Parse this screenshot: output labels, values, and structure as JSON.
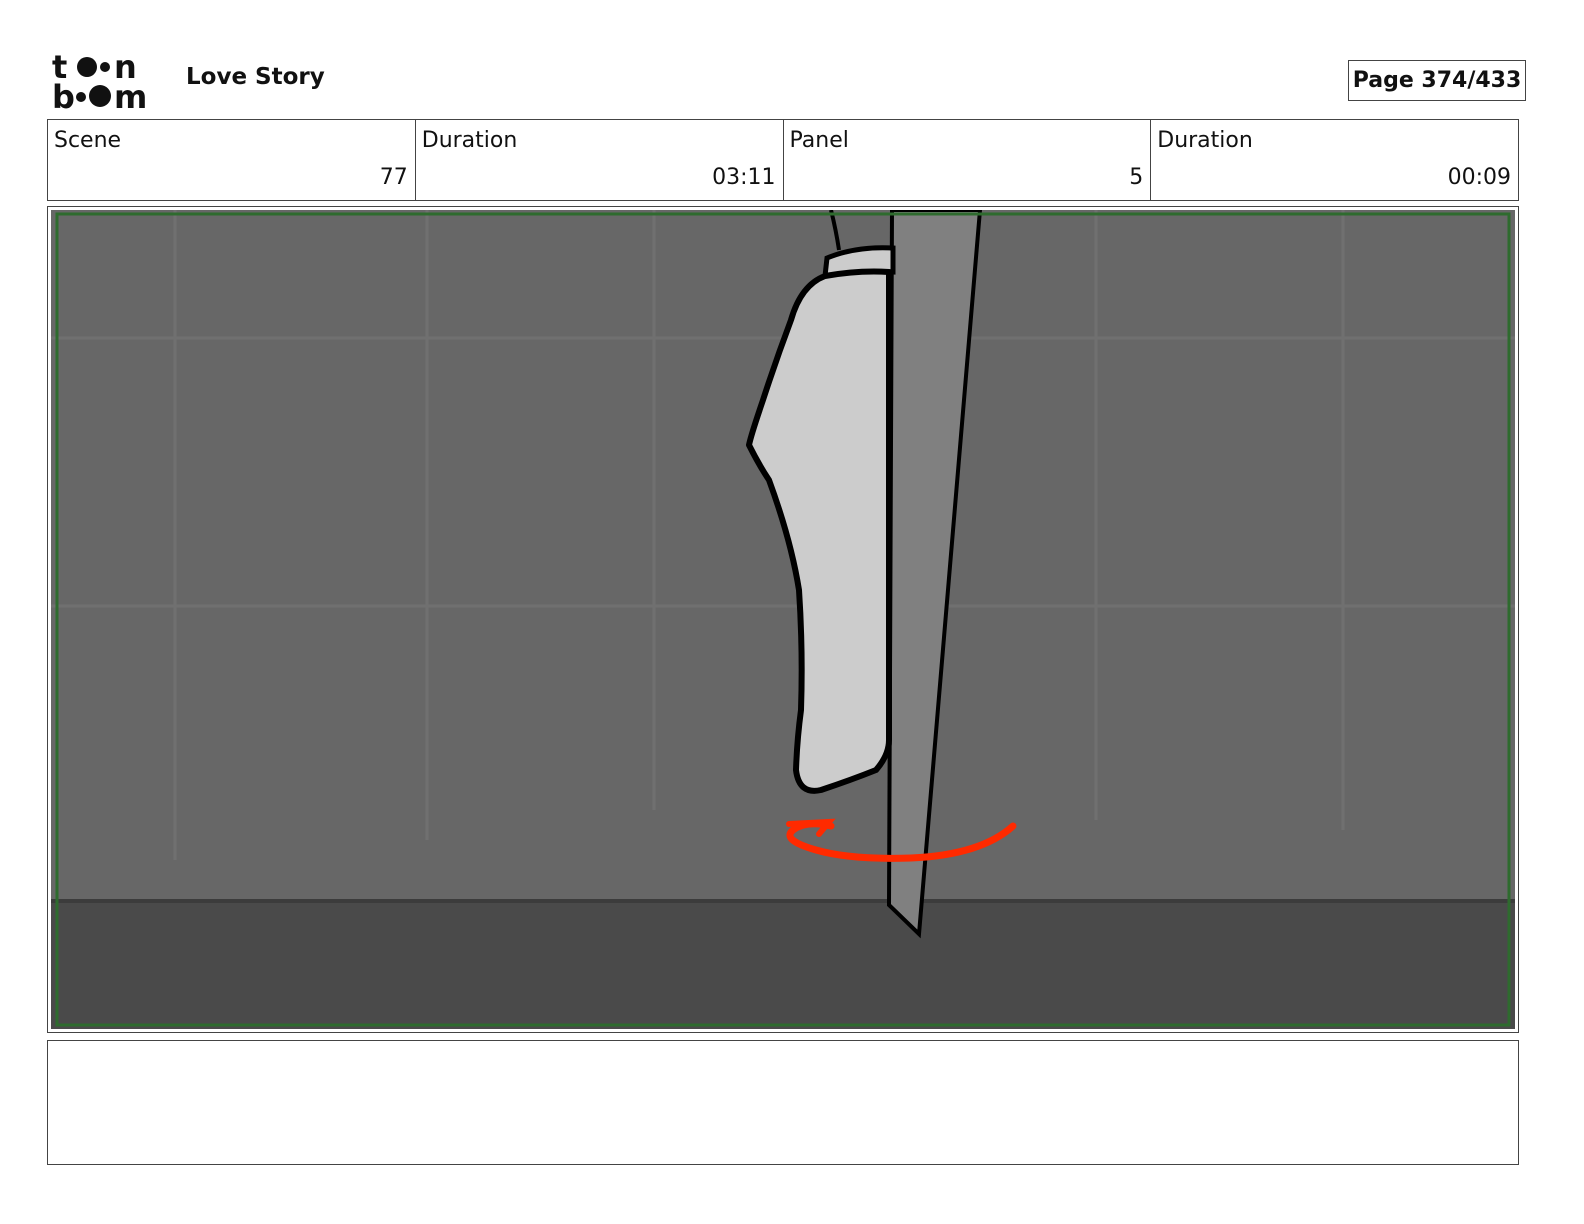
{
  "header": {
    "logo_text": "toon boom",
    "project_title": "Love Story",
    "page_label": "Page 374/433"
  },
  "info": {
    "scene_label": "Scene",
    "scene_value": "77",
    "scene_duration_label": "Duration",
    "scene_duration_value": "03:11",
    "panel_label": "Panel",
    "panel_value": "5",
    "panel_duration_label": "Duration",
    "panel_duration_value": "00:09"
  },
  "panel": {
    "colors": {
      "wall": "#676767",
      "floor": "#4a4a4a",
      "safe_frame": "#2e6b2e",
      "motion_arrow": "#ff2a00",
      "sketch_fill": "#cccccc"
    }
  },
  "notes": {
    "text": ""
  }
}
